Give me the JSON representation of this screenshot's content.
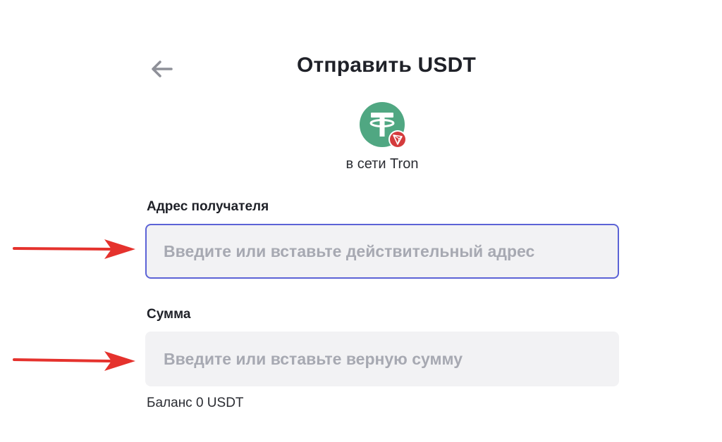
{
  "header": {
    "title": "Отправить USDT",
    "back_icon": "arrow-left-icon"
  },
  "token": {
    "logo_icon": "tether-usdt-icon",
    "network_badge_icon": "tron-icon",
    "network_label": "в сети Tron",
    "colors": {
      "tether_green": "#50A782",
      "tron_red": "#D43B3C"
    }
  },
  "form": {
    "address": {
      "label": "Адрес получателя",
      "placeholder": "Введите или вставьте действительный адрес",
      "value": "",
      "focused": true
    },
    "amount": {
      "label": "Сумма",
      "placeholder": "Введите или вставьте верную сумму",
      "value": ""
    },
    "balance_text": "Баланс 0 USDT"
  },
  "colors": {
    "focus_border": "#5C63D6",
    "input_bg": "#F2F2F4",
    "annotation_arrow": "#E5322D"
  }
}
